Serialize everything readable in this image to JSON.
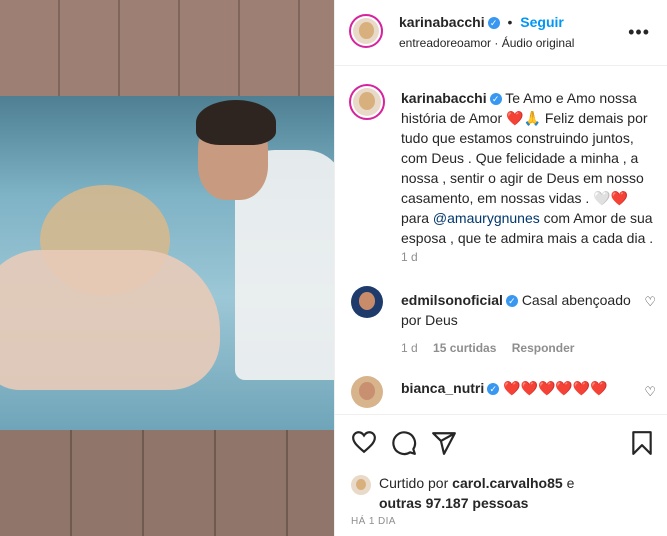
{
  "post": {
    "author": "karinabacchi",
    "follow_label": "Seguir",
    "audio": "entreadoreoamor · Áudio original",
    "more_icon": "more-dots-icon"
  },
  "caption": {
    "author": "karinabacchi",
    "text_1": "Te Amo e Amo nossa história de Amor",
    "text_2": "Feliz demais por tudo que estamos construindo juntos, com Deus . Que felicidade a minha , a nossa , sentir o agir de Deus em nosso casamento, em nossas vidas .",
    "text_3": "para",
    "mention": "@amaurygnunes",
    "text_4": "com Amor de sua esposa , que te admira mais a cada dia .",
    "emojis_1": "❤️🙏",
    "emojis_2": "🤍❤️",
    "time": "1 d"
  },
  "comments": [
    {
      "user": "edmilsonoficial",
      "text": "Casal abençoado por Deus",
      "time": "1 d",
      "likes": "15 curtidas",
      "reply_label": "Responder"
    },
    {
      "user": "bianca_nutri",
      "text": "❤️❤️❤️❤️❤️❤️"
    }
  ],
  "actions": {
    "like_icon": "heart-icon",
    "comment_icon": "comment-icon",
    "share_icon": "share-icon",
    "save_icon": "bookmark-icon"
  },
  "likes": {
    "prefix": "Curtido por",
    "user": "carol.carvalho85",
    "mid": "e",
    "others": "outras 97.187 pessoas"
  },
  "posted_ago": "HÁ 1 DIA"
}
